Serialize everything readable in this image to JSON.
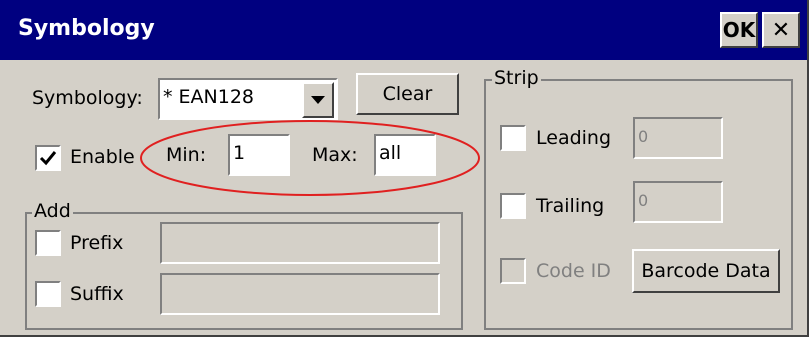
{
  "window": {
    "title": "Symbology",
    "ok_label": "OK",
    "close_label": "✕"
  },
  "symbology": {
    "label": "Symbology:",
    "selected": "* EAN128",
    "clear_label": "Clear"
  },
  "enable": {
    "label": "Enable",
    "checked": true
  },
  "length": {
    "min_label": "Min:",
    "min_value": "1",
    "max_label": "Max:",
    "max_value": "all"
  },
  "add": {
    "title": "Add",
    "prefix_label": "Prefix",
    "prefix_value": "",
    "suffix_label": "Suffix",
    "suffix_value": ""
  },
  "strip": {
    "title": "Strip",
    "leading_label": "Leading",
    "leading_value": "0",
    "trailing_label": "Trailing",
    "trailing_value": "0",
    "codeid_label": "Code ID",
    "barcode_data_label": "Barcode Data"
  },
  "colors": {
    "titlebar": "#000080",
    "face": "#d4d0c8",
    "highlight_ellipse": "#e02020"
  }
}
